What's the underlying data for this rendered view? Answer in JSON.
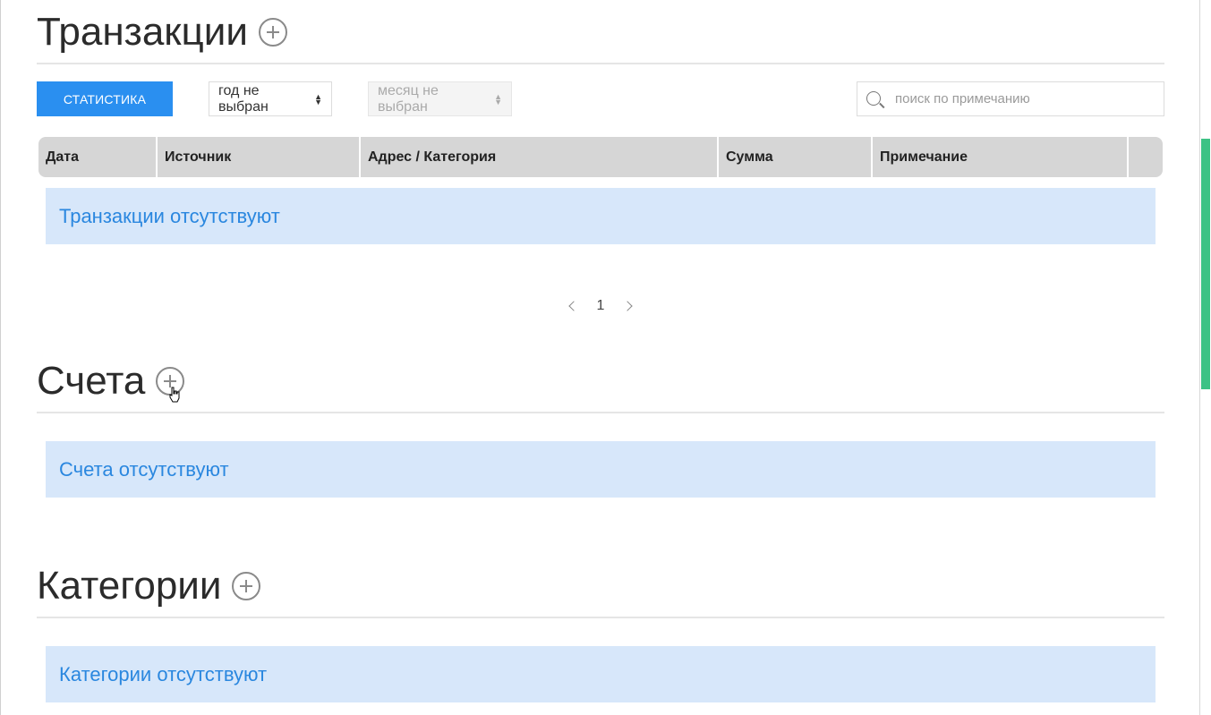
{
  "transactions": {
    "title": "Транзакции",
    "stats_button": "Статистика",
    "year_select": "год не выбран",
    "month_select": "месяц не выбран",
    "search_placeholder": "поиск по примечанию",
    "columns": [
      "Дата",
      "Источник",
      "Адрес / Категория",
      "Сумма",
      "Примечание",
      ""
    ],
    "empty_message": "Транзакции отсутствуют",
    "pagination": {
      "current_page": "1"
    }
  },
  "accounts": {
    "title": "Счета",
    "empty_message": "Счета отсутствуют"
  },
  "categories": {
    "title": "Категории",
    "empty_message": "Категории отсутствуют"
  },
  "colors": {
    "accent": "#2a8ff0",
    "empty_bg": "#d7e7fa",
    "empty_text": "#2a87df",
    "table_header_bg": "#d6d6d6",
    "scrollbar": "#3dc285"
  },
  "icons": [
    "add-circle-icon",
    "search-icon",
    "chevron-left-icon",
    "chevron-right-icon",
    "select-arrows-icon",
    "hand-cursor-icon"
  ]
}
